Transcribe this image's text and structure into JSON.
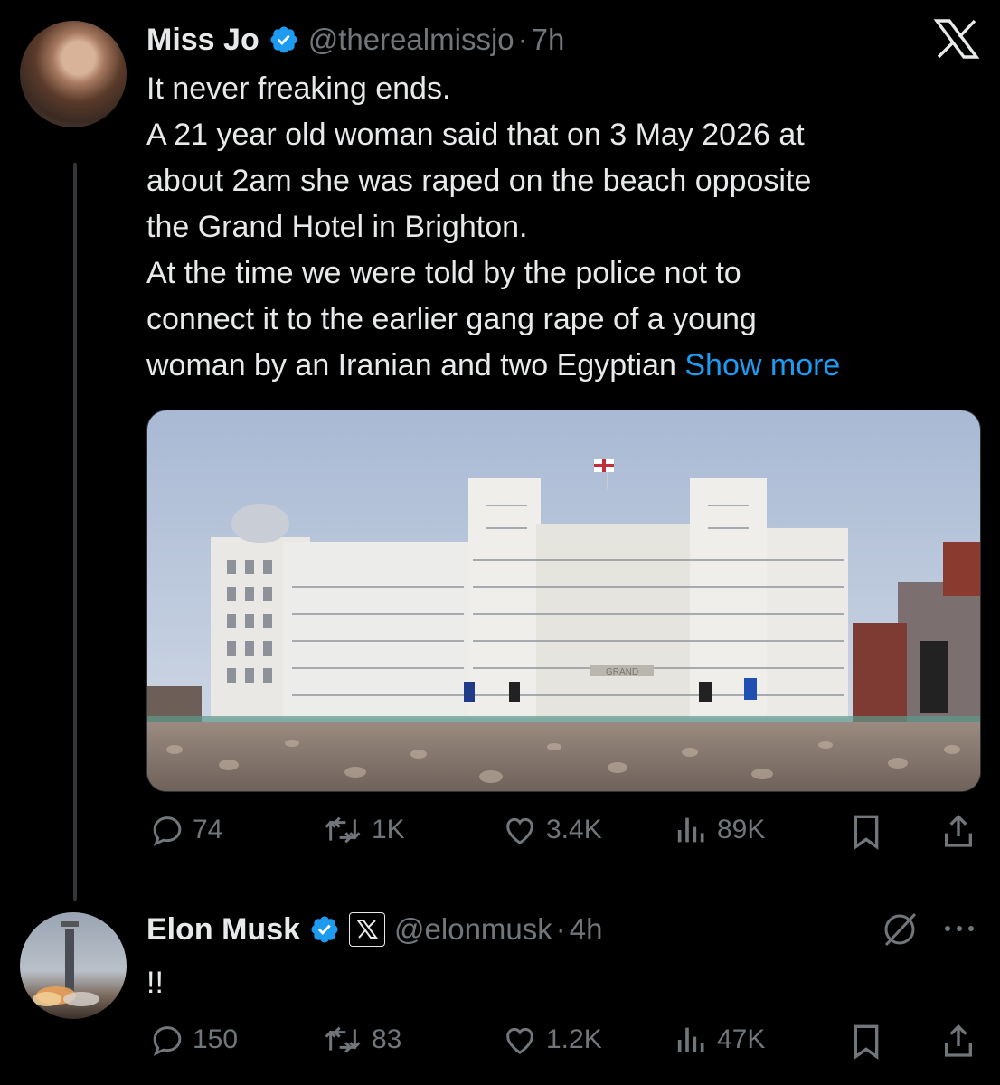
{
  "tweet1": {
    "name": "Miss Jo",
    "handle": "@therealmissjo",
    "separator": "·",
    "time": "7h",
    "lines": [
      "It never freaking ends.",
      "A 21 year old woman said that on 3 May 2026 at",
      "about 2am she was raped on the beach opposite",
      "the Grand Hotel in Brighton.",
      "At the time we were told by the police not to",
      "connect it to the earlier gang rape of a young"
    ],
    "last_line": "woman by an Iranian and two Egyptian",
    "show_more": "Show more",
    "image_sign": "GRAND",
    "stats": {
      "replies": "74",
      "reposts": "1K",
      "likes": "3.4K",
      "views": "89K"
    }
  },
  "tweet2": {
    "name": "Elon Musk",
    "handle": "@elonmusk",
    "separator": "·",
    "time": "4h",
    "text": "!!",
    "stats": {
      "replies": "150",
      "reposts": "83",
      "likes": "1.2K",
      "views": "47K"
    }
  },
  "icons": {
    "verified": "verified-badge-icon",
    "x_logo": "x-logo-icon",
    "reply": "reply-icon",
    "repost": "repost-icon",
    "like": "heart-icon",
    "views": "views-icon",
    "bookmark": "bookmark-icon",
    "share": "share-icon",
    "grok": "grok-icon",
    "more": "more-icon"
  },
  "colors": {
    "accent": "#1d9bf0",
    "muted": "#71767b",
    "text": "#e7e9ea",
    "background": "#000000"
  }
}
